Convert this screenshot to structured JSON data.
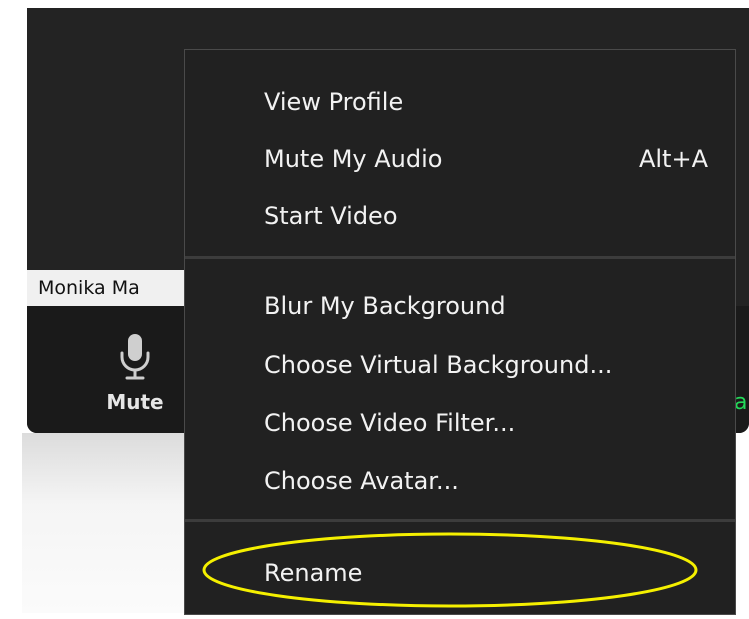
{
  "participant": {
    "name": "Monika Ma"
  },
  "toolbar": {
    "mute_label": "Mute",
    "mute_icon": "microphone-icon",
    "right_edge_glyph": "a",
    "accent_color": "#23d959"
  },
  "menu": {
    "sections": [
      {
        "items": [
          {
            "label": "View Profile",
            "shortcut": ""
          },
          {
            "label": "Mute My Audio",
            "shortcut": "Alt+A"
          },
          {
            "label": "Start Video",
            "shortcut": ""
          }
        ]
      },
      {
        "items": [
          {
            "label": "Blur My Background",
            "shortcut": ""
          },
          {
            "label": "Choose Virtual Background...",
            "shortcut": ""
          },
          {
            "label": "Choose Video Filter...",
            "shortcut": ""
          },
          {
            "label": "Choose Avatar...",
            "shortcut": ""
          }
        ]
      },
      {
        "items": [
          {
            "label": "Rename",
            "shortcut": ""
          }
        ]
      }
    ],
    "highlighted_item": "Rename",
    "highlight_color": "#f5f000"
  }
}
